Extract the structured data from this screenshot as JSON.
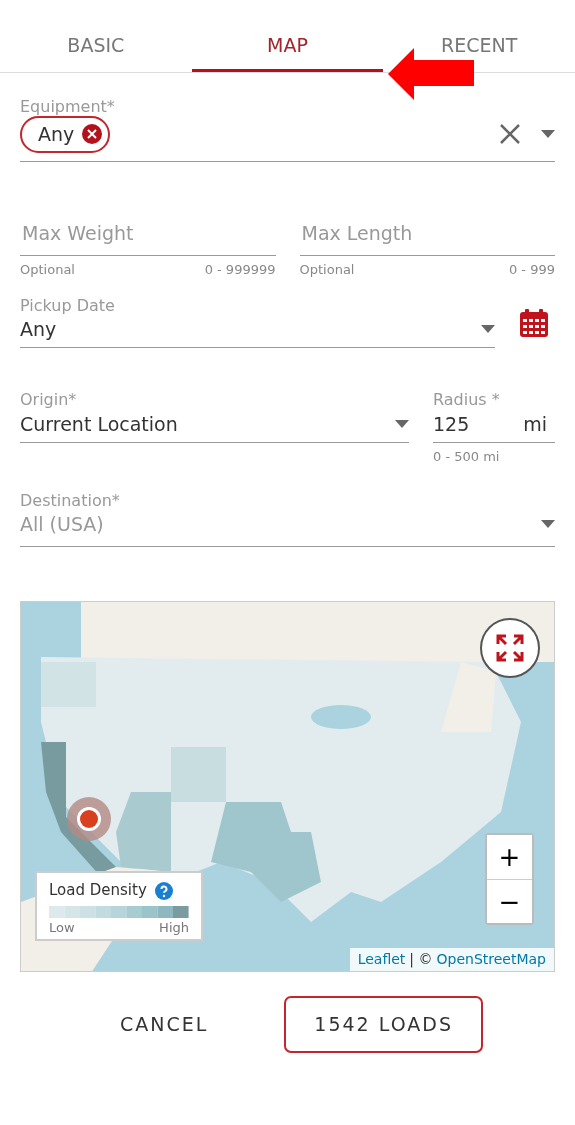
{
  "tabs": [
    {
      "label": "BASIC",
      "selected": false
    },
    {
      "label": "MAP",
      "selected": true
    },
    {
      "label": "RECENT",
      "selected": false
    }
  ],
  "equipment": {
    "label": "Equipment*",
    "chips": [
      {
        "label": "Any"
      }
    ]
  },
  "max_weight": {
    "placeholder": "Max Weight",
    "hint": "Optional",
    "range": "0 - 999999"
  },
  "max_length": {
    "placeholder": "Max Length",
    "hint": "Optional",
    "range": "0 - 999"
  },
  "pickup_date": {
    "label": "Pickup Date",
    "value": "Any"
  },
  "origin": {
    "label": "Origin*",
    "value": "Current Location"
  },
  "radius": {
    "label": "Radius *",
    "value": "125",
    "unit": "mi",
    "range": "0 - 500 mi"
  },
  "destination": {
    "label": "Destination*",
    "placeholder": "All (USA)"
  },
  "map": {
    "zoom_buttons": [
      "+",
      "−"
    ],
    "legend": {
      "title": "Load Density",
      "low": "Low",
      "high": "High"
    },
    "attribution": [
      {
        "kind": "link",
        "text": "Leaflet"
      },
      {
        "kind": "text",
        "text": "| ©"
      },
      {
        "kind": "link",
        "text": "OpenStreetMap"
      }
    ]
  },
  "buttons": [
    {
      "label": "CANCEL",
      "kind": "text"
    },
    {
      "label": "1542 LOADS",
      "kind": "outline"
    }
  ]
}
